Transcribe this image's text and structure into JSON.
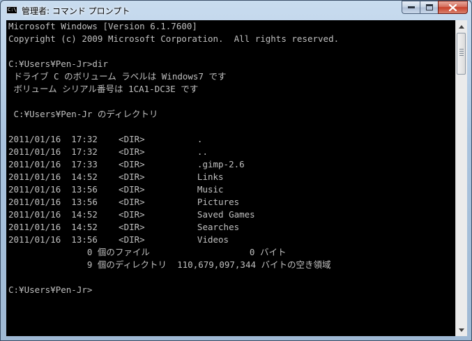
{
  "window": {
    "title": "管理者: コマンド プロンプト",
    "icon_name": "cmd-icon",
    "icon_text": "C:\\."
  },
  "console": {
    "lines": [
      "Microsoft Windows [Version 6.1.7600]",
      "Copyright (c) 2009 Microsoft Corporation.  All rights reserved.",
      "",
      "C:¥Users¥Pen-Jr>dir",
      " ドライブ C のボリューム ラベルは Windows7 です",
      " ボリューム シリアル番号は 1CA1-DC3E です",
      "",
      " C:¥Users¥Pen-Jr のディレクトリ",
      "",
      "2011/01/16  17:32    <DIR>          .",
      "2011/01/16  17:32    <DIR>          ..",
      "2011/01/16  17:33    <DIR>          .gimp-2.6",
      "2011/01/16  14:52    <DIR>          Links",
      "2011/01/16  13:56    <DIR>          Music",
      "2011/01/16  13:56    <DIR>          Pictures",
      "2011/01/16  14:52    <DIR>          Saved Games",
      "2011/01/16  14:52    <DIR>          Searches",
      "2011/01/16  13:56    <DIR>          Videos",
      "               0 個のファイル                   0 バイト",
      "               9 個のディレクトリ  110,679,097,344 バイトの空き領域",
      "",
      "C:¥Users¥Pen-Jr>"
    ]
  },
  "colors": {
    "console_background": "#000000",
    "console_text": "#c0c0c0",
    "close_button": "#c8402a"
  }
}
